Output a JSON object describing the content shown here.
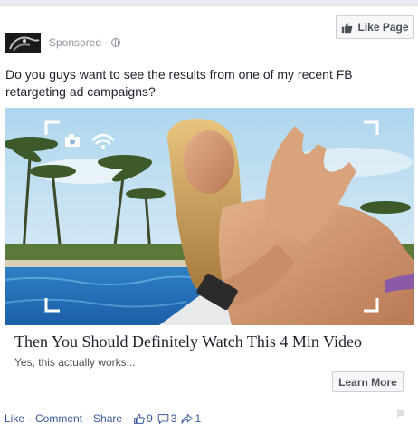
{
  "header": {
    "sponsored_label": "Sponsored · "
  },
  "like_page_button": {
    "label": "Like Page"
  },
  "post": {
    "text": "Do you guys want to see the results from one of my recent FB retargeting ad campaigns?"
  },
  "link_preview": {
    "headline": "Then You Should Definitely Watch This 4 Min Video",
    "subtext": "Yes, this actually works...",
    "cta_label": "Learn More"
  },
  "footer": {
    "like_label": "Like",
    "comment_label": "Comment",
    "share_label": "Share",
    "separator": "·",
    "likes_count": "9",
    "comments_count": "3",
    "shares_count": "1"
  },
  "colors": {
    "link_blue": "#365899",
    "meta_gray": "#90949c",
    "button_bg": "#f6f7f9",
    "button_border": "#ccd0d5"
  }
}
